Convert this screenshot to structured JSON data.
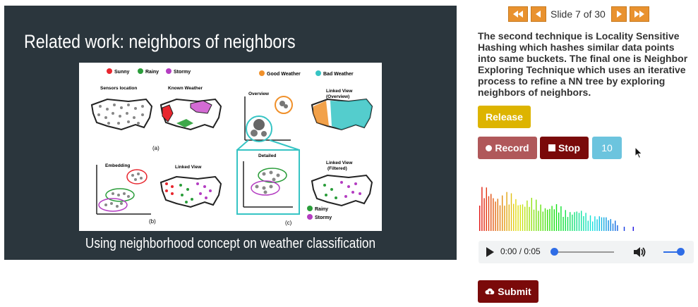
{
  "slide": {
    "title": "Related work: neighbors of neighbors",
    "caption": "Using neighborhood concept on weather classification",
    "figure": {
      "legend_left": [
        "Sunny",
        "Rainy",
        "Stormy"
      ],
      "legend_right": [
        "Good Weather",
        "Bad Weather"
      ],
      "labels": {
        "sensors": "Sensors location",
        "known": "Known Weather",
        "embedding": "Embedding",
        "linked": "Linked View",
        "overview": "Overview",
        "linked_overview_1": "Linked View",
        "linked_overview_2": "(Overview)",
        "detailed": "Detailed",
        "linked_filtered_1": "Linked View",
        "linked_filtered_2": "(Filtered)",
        "panel_a": "(a)",
        "panel_b": "(b)",
        "panel_c": "(c)",
        "rainy": "Rainy",
        "stormy": "Stormy"
      },
      "colors": {
        "sunny": "#e8262e",
        "rainy": "#2a9d3a",
        "stormy": "#b43dc2",
        "good": "#f0902a",
        "bad": "#36c4c4"
      }
    }
  },
  "nav": {
    "first_icon": "fast-backward-icon",
    "prev_icon": "backward-icon",
    "next_icon": "forward-icon",
    "last_icon": "fast-forward-icon",
    "counter": "Slide 7 of 30"
  },
  "description": "The second technique is Locality Sensitive Hashing which hashes similar data points into same buckets. The final one is Neighbor Exploring Technique which uses an iterative process to refine a NN tree by exploring neighbors of neighbors.",
  "buttons": {
    "release": "Release",
    "record": "Record",
    "stop": "Stop",
    "count": "10",
    "submit": "Submit"
  },
  "audio": {
    "time": "0:00 / 0:05",
    "progress": 0,
    "volume": 1
  }
}
